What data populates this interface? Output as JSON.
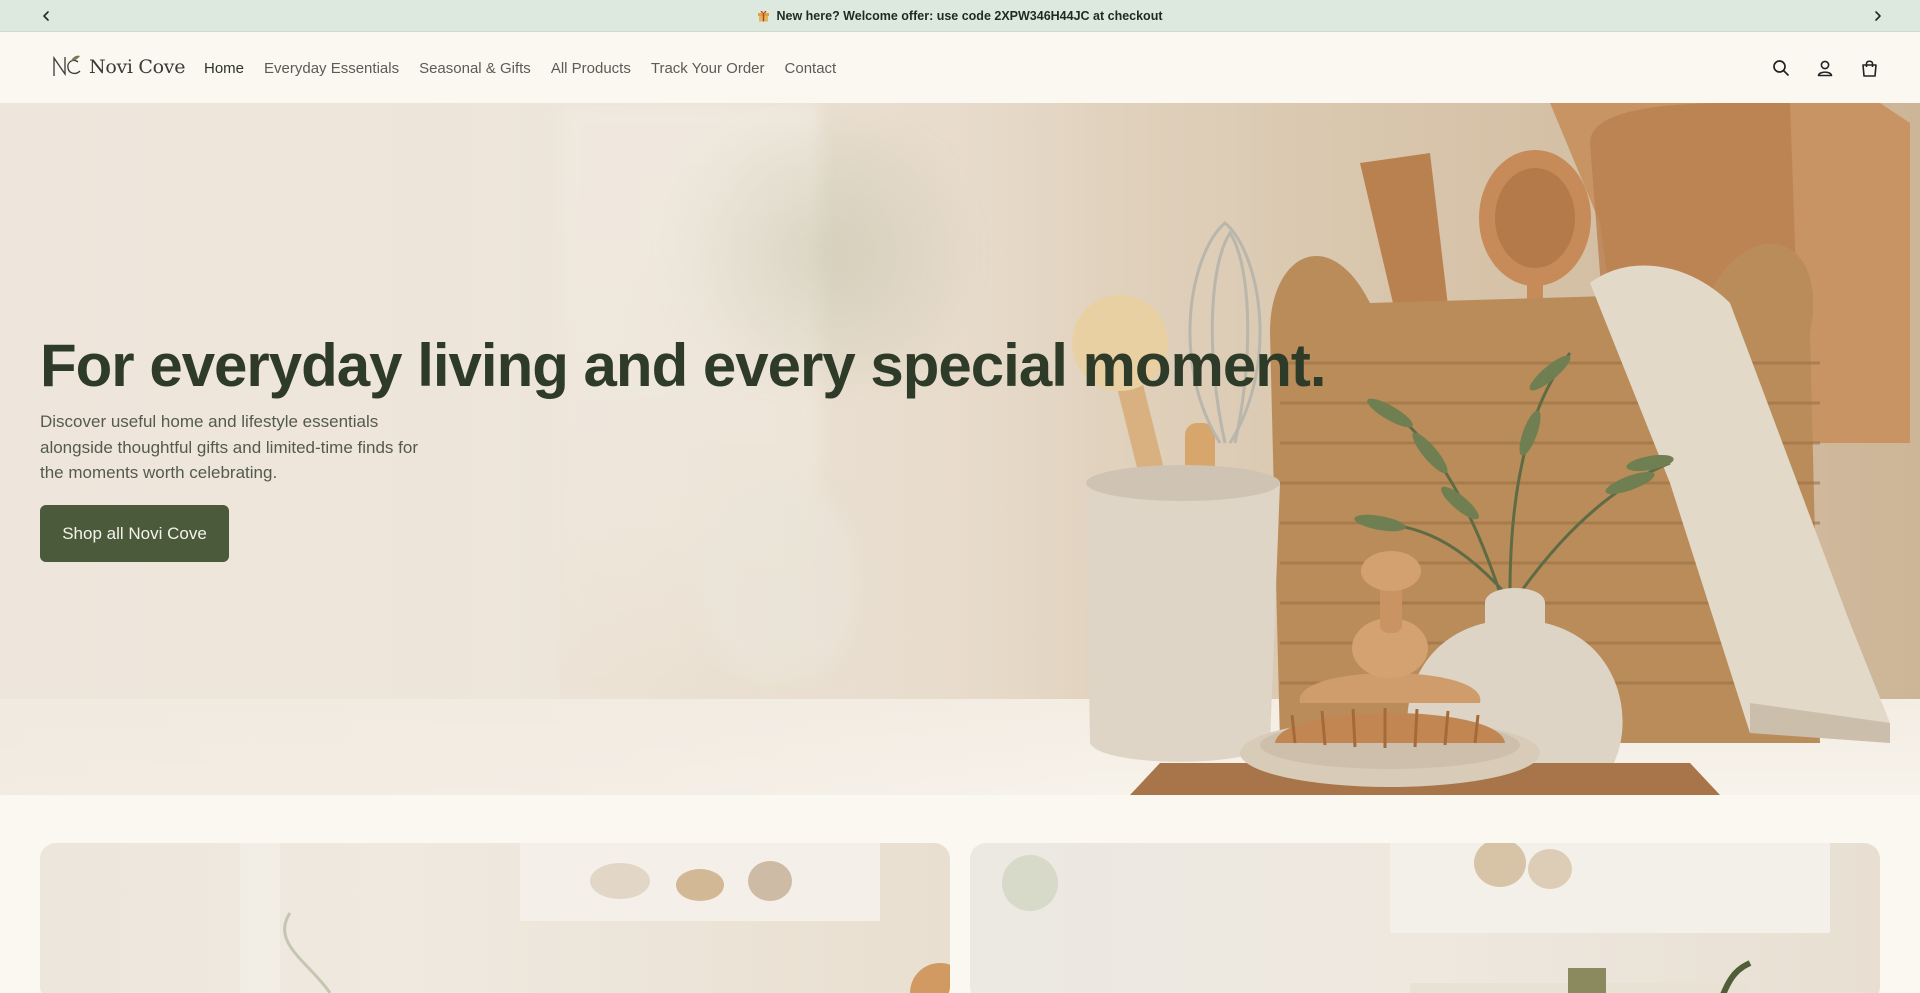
{
  "announcement": {
    "text": "New here? Welcome offer: use code 2XPW346H44JC at checkout",
    "icon": "gift-icon"
  },
  "brand": {
    "name": "Novi Cove"
  },
  "nav": {
    "items": [
      {
        "label": "Home",
        "active": true
      },
      {
        "label": "Everyday Essentials",
        "active": false
      },
      {
        "label": "Seasonal & Gifts",
        "active": false
      },
      {
        "label": "All Products",
        "active": false
      },
      {
        "label": "Track Your Order",
        "active": false
      },
      {
        "label": "Contact",
        "active": false
      }
    ]
  },
  "header_icons": [
    "search-icon",
    "account-icon",
    "cart-icon"
  ],
  "hero": {
    "title": "For everyday living and every special moment.",
    "subtitle": "Discover useful home and lifestyle essentials alongside thoughtful gifts and limited-time finds for the moments worth celebrating.",
    "cta_label": "Shop all Novi Cove"
  },
  "colors": {
    "announcement_bg": "#dde8df",
    "page_bg": "#fbf8f1",
    "accent": "#4a5a3b",
    "heading": "#2f3b29"
  }
}
